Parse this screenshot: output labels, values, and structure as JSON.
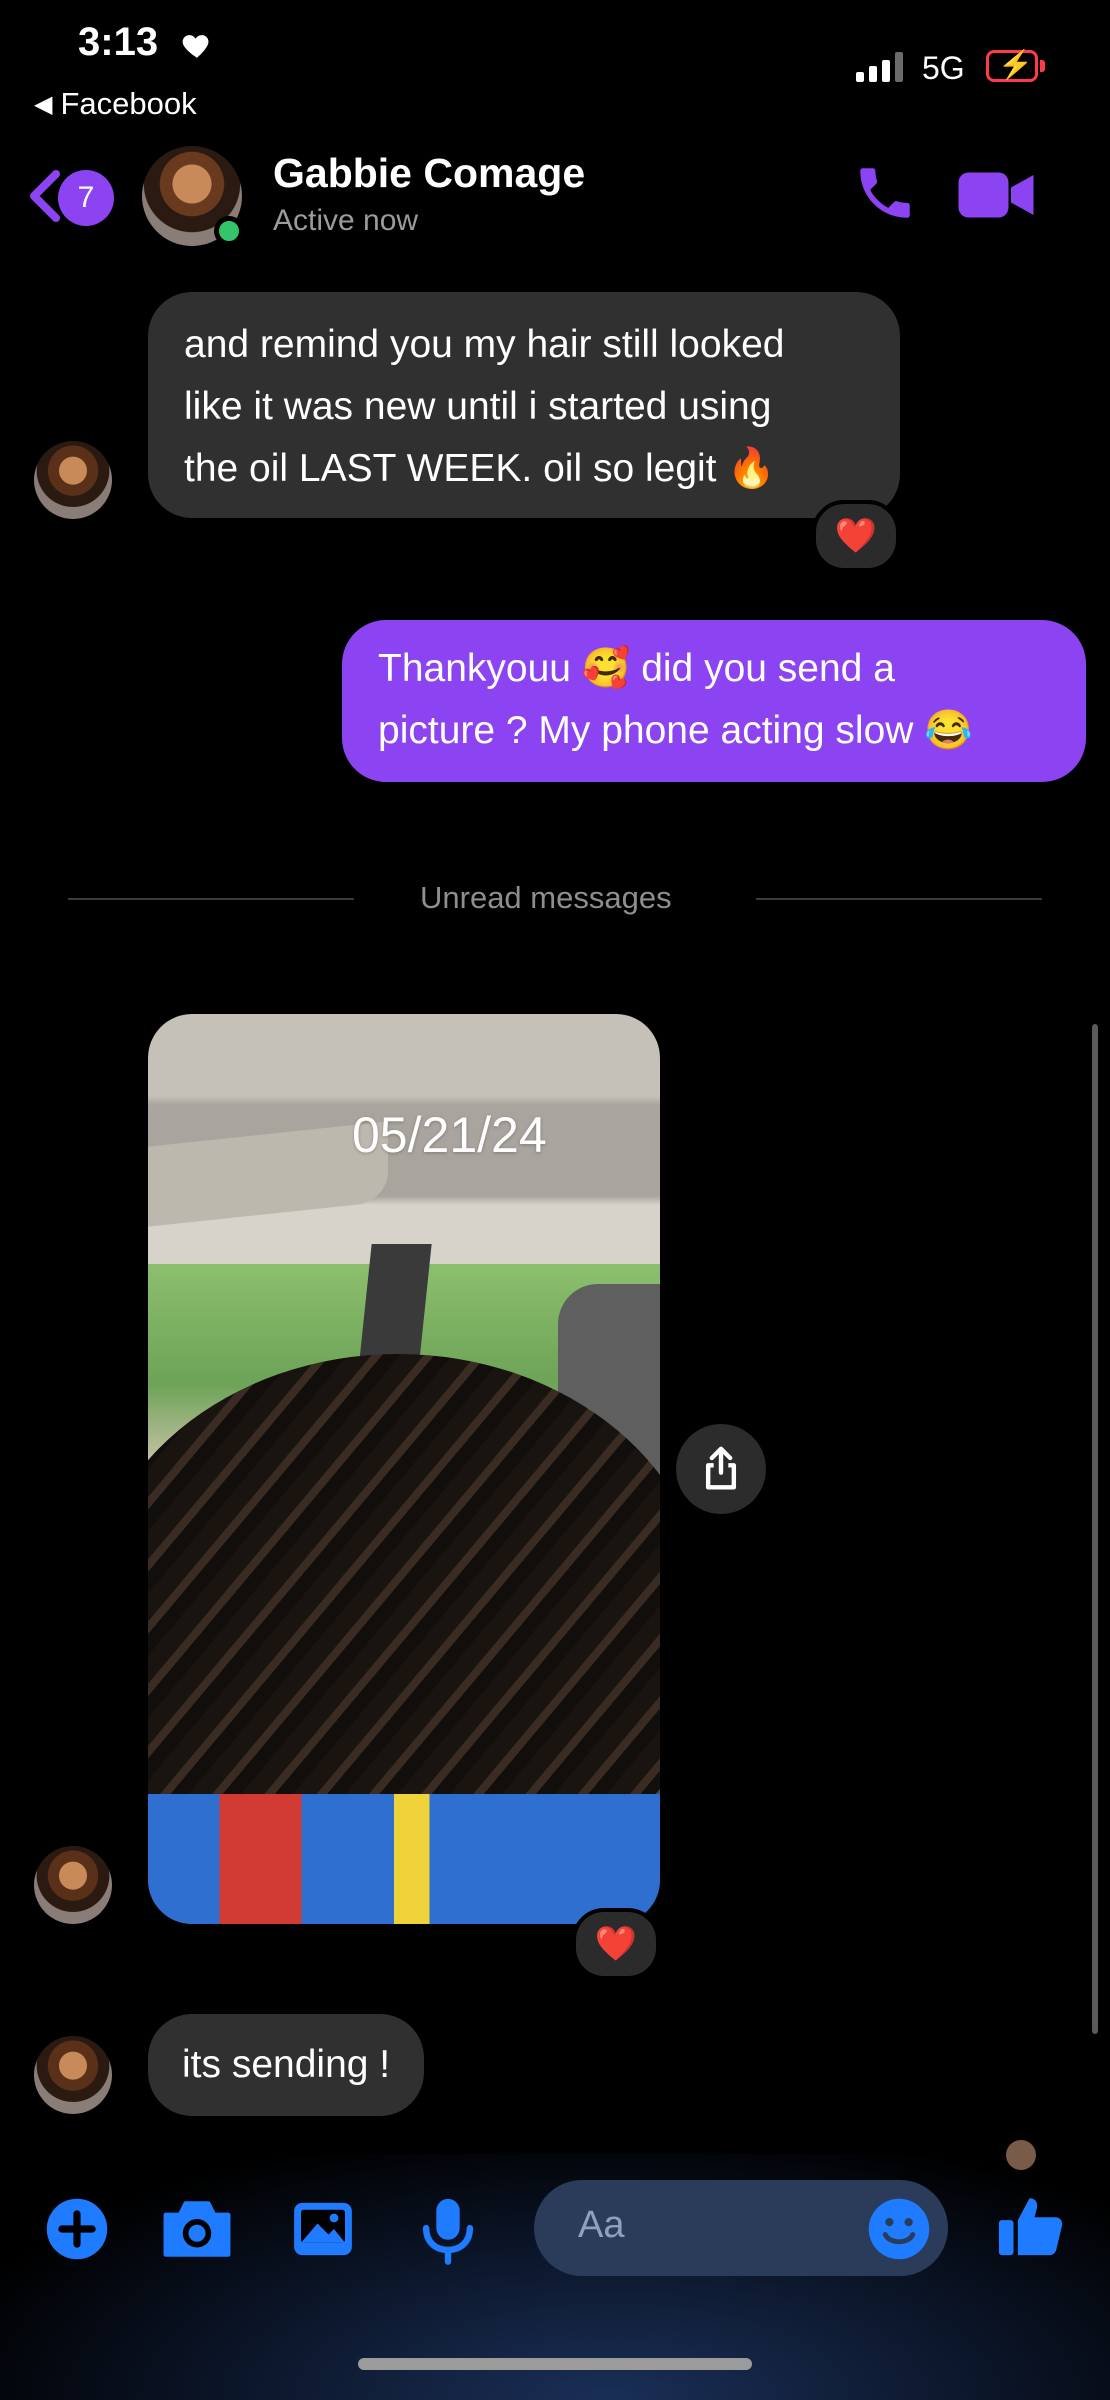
{
  "status_bar": {
    "time": "3:13",
    "back_app": "Facebook",
    "network": "5G"
  },
  "header": {
    "unread_count": "7",
    "contact_name": "Gabbie Comage",
    "contact_status": "Active now",
    "call_icon": "phone-icon",
    "video_icon": "video-camera-icon"
  },
  "messages": {
    "incoming_1": {
      "lines": [
        "and remind you my hair still looked",
        "like it was new until i started using",
        "the oil LAST WEEK. oil so legit 🔥"
      ],
      "reaction": "❤️"
    },
    "outgoing_1": {
      "lines": [
        "Thankyouu 🥰 did you send a",
        "picture ? My phone acting slow 😂"
      ]
    },
    "divider": "Unread messages",
    "photo": {
      "date_overlay": "05/21/24",
      "reaction": "❤️"
    },
    "incoming_2": {
      "text": "its sending !"
    }
  },
  "composer": {
    "placeholder": "Aa"
  },
  "colors": {
    "accent": "#8c43f2",
    "toolbar_blue": "#1f7bff",
    "incoming_bubble": "#303030"
  }
}
